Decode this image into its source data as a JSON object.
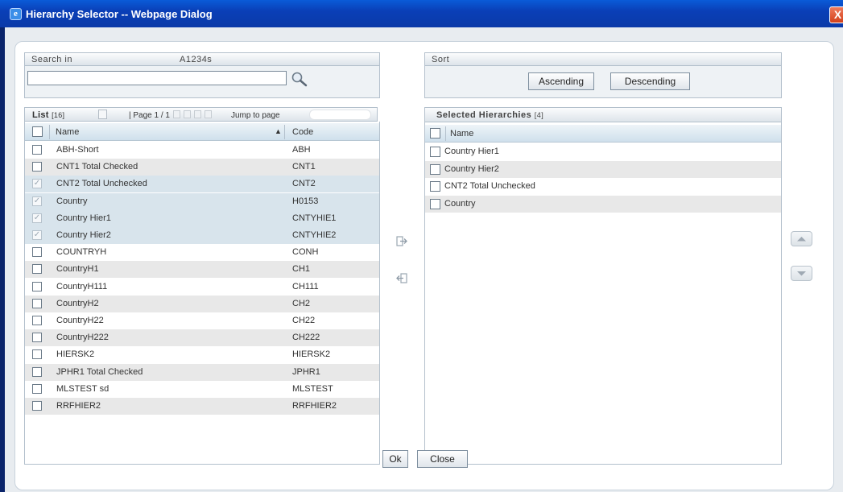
{
  "window": {
    "title": "Hierarchy Selector -- Webpage Dialog",
    "close_glyph": "X"
  },
  "search": {
    "header_label": "Search in",
    "header_value": "A1234s",
    "input_value": "",
    "icon": "magnifier-icon"
  },
  "sort": {
    "header_label": "Sort",
    "ascending_label": "Ascending",
    "descending_label": "Descending"
  },
  "list": {
    "title": "List",
    "count": "[16]",
    "page_text": "| Page 1 / 1",
    "jump_label": "Jump to page",
    "col_name": "Name",
    "col_code": "Code",
    "sort_glyph": "▲",
    "rows": [
      {
        "name": "ABH-Short",
        "code": "ABH",
        "selected": false
      },
      {
        "name": "CNT1 Total Checked",
        "code": "CNT1",
        "selected": false
      },
      {
        "name": "CNT2 Total Unchecked",
        "code": "CNT2",
        "selected": true
      },
      {
        "name": "Country",
        "code": "H0153",
        "selected": true
      },
      {
        "name": "Country Hier1",
        "code": "CNTYHIE1",
        "selected": true
      },
      {
        "name": "Country Hier2",
        "code": "CNTYHIE2",
        "selected": true
      },
      {
        "name": "COUNTRYH",
        "code": "CONH",
        "selected": false
      },
      {
        "name": "CountryH1",
        "code": "CH1",
        "selected": false
      },
      {
        "name": "CountryH111",
        "code": "CH111",
        "selected": false
      },
      {
        "name": "CountryH2",
        "code": "CH2",
        "selected": false
      },
      {
        "name": "CountryH22",
        "code": "CH22",
        "selected": false
      },
      {
        "name": "CountryH222",
        "code": "CH222",
        "selected": false
      },
      {
        "name": "HIERSK2",
        "code": "HIERSK2",
        "selected": false
      },
      {
        "name": "JPHR1 Total Checked",
        "code": "JPHR1",
        "selected": false
      },
      {
        "name": "MLSTEST sd",
        "code": "MLSTEST",
        "selected": false
      },
      {
        "name": "RRFHIER2",
        "code": "RRFHIER2",
        "selected": false
      }
    ]
  },
  "selected": {
    "title": "Selected Hierarchies",
    "count": "[4]",
    "col_name": "Name",
    "rows": [
      {
        "name": "Country Hier1"
      },
      {
        "name": "Country Hier2"
      },
      {
        "name": "CNT2 Total Unchecked"
      },
      {
        "name": "Country"
      }
    ]
  },
  "footer": {
    "ok_label": "Ok",
    "close_label": "Close"
  },
  "colors": {
    "row_alt": "#e8e8e8",
    "row_selected": "#d8e4ec",
    "titlebar": "#0a46c0"
  }
}
